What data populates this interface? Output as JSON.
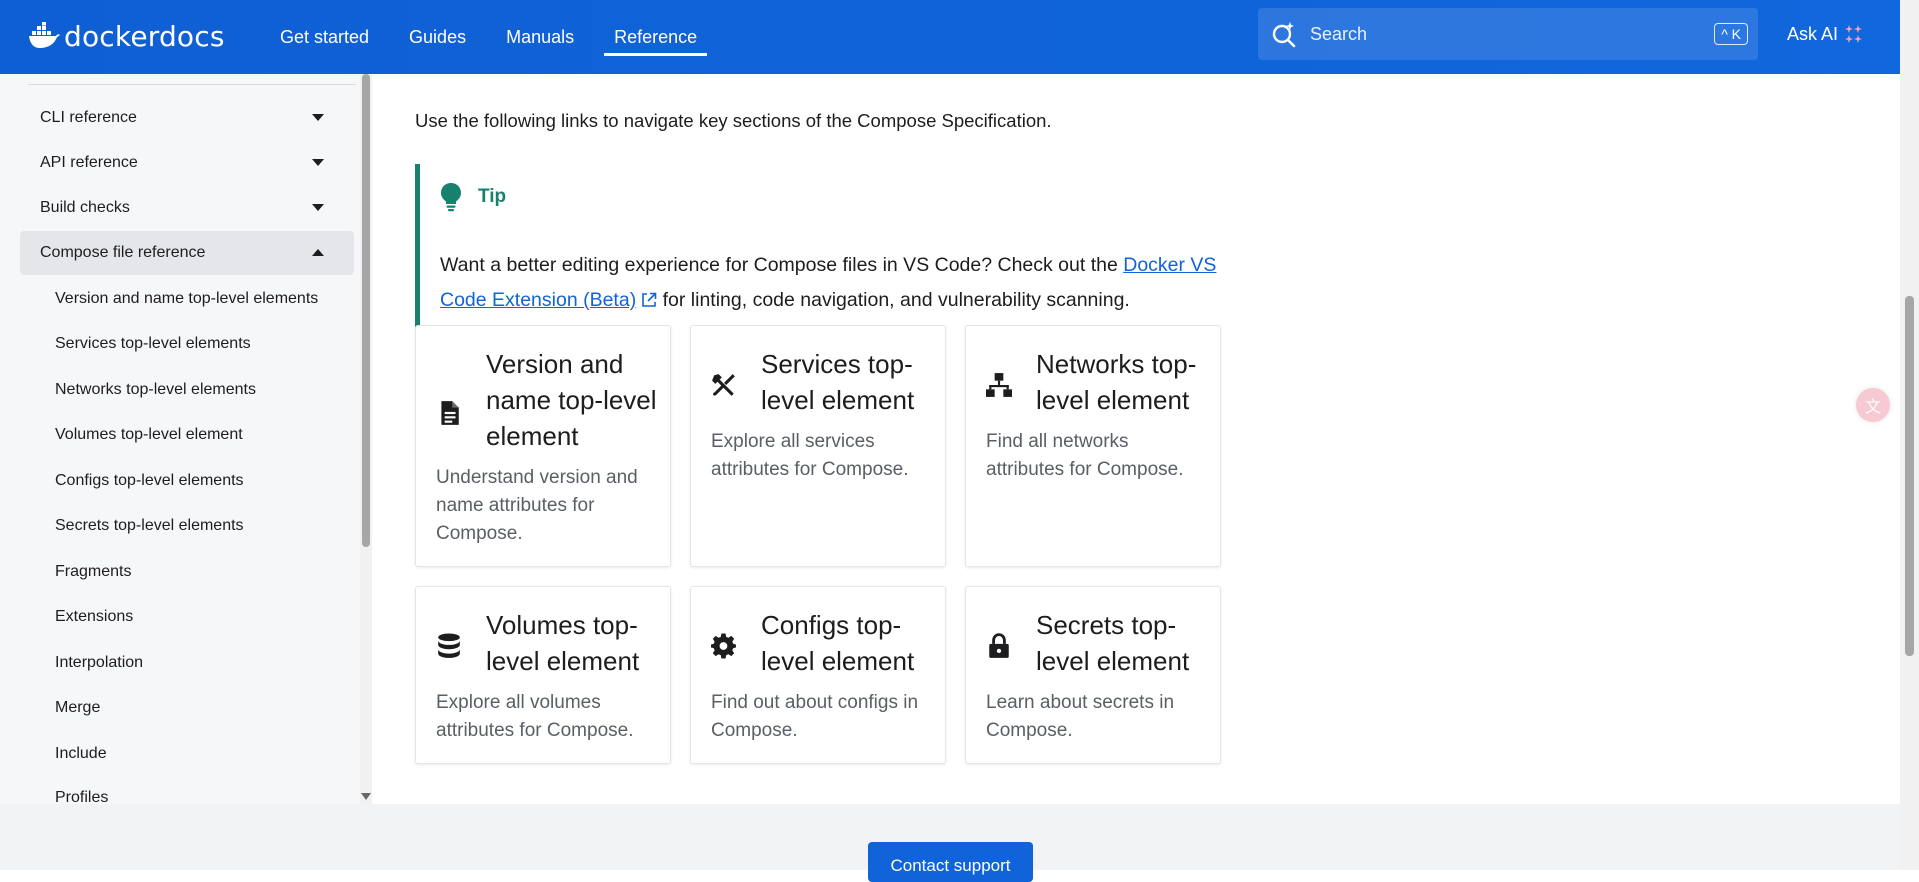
{
  "header": {
    "brand": "dockerdocs",
    "nav": [
      "Get started",
      "Guides",
      "Manuals",
      "Reference"
    ],
    "active_nav": "Reference",
    "search_placeholder": "Search",
    "search_shortcut": "^ K",
    "ask_ai_label": "Ask AI",
    "bg_color": "#1063d9"
  },
  "sidebar": {
    "sections": [
      {
        "label": "CLI reference",
        "expanded": false
      },
      {
        "label": "API reference",
        "expanded": false
      },
      {
        "label": "Build checks",
        "expanded": false
      },
      {
        "label": "Compose file reference",
        "expanded": true
      }
    ],
    "sub_items": [
      "Version and name top-level elements",
      "Services top-level elements",
      "Networks top-level elements",
      "Volumes top-level element",
      "Configs top-level elements",
      "Secrets top-level elements",
      "Fragments",
      "Extensions",
      "Interpolation",
      "Merge",
      "Include",
      "Profiles"
    ]
  },
  "main": {
    "intro": "Use the following links to navigate key sections of the Compose Specification.",
    "tip": {
      "title": "Tip",
      "text_before": "Want a better editing experience for Compose files in VS Code? Check out the ",
      "link_text": "Docker VS Code Extension (Beta)",
      "text_after": " for linting, code navigation, and vulnerability scanning.",
      "accent_color": "#17806f"
    },
    "cards": [
      {
        "icon": "document-icon",
        "title": "Version and name top-level element",
        "description": "Understand version and name attributes for Compose."
      },
      {
        "icon": "tools-icon",
        "title": "Services top-level element",
        "description": "Explore all services attributes for Compose."
      },
      {
        "icon": "network-icon",
        "title": "Networks top-level element",
        "description": "Find all networks attributes for Compose."
      },
      {
        "icon": "database-icon",
        "title": "Volumes top-level element",
        "description": "Explore all volumes attributes for Compose."
      },
      {
        "icon": "gear-icon",
        "title": "Configs top-level element",
        "description": "Find out about configs in Compose."
      },
      {
        "icon": "lock-icon",
        "title": "Secrets top-level element",
        "description": "Learn about secrets in Compose."
      }
    ]
  },
  "footer": {
    "contact_label": "Contact support"
  }
}
